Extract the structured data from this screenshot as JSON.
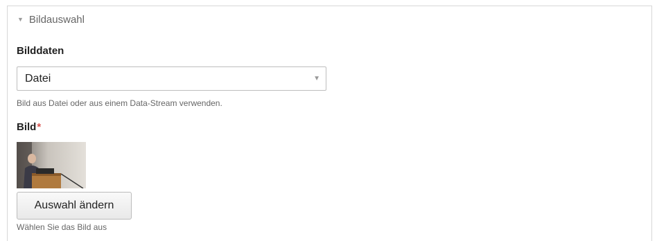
{
  "fieldset": {
    "title": "Bildauswahl",
    "collapse_icon": "triangle-down-icon"
  },
  "image_data": {
    "label": "Bilddaten",
    "select_value": "Datei",
    "select_arrow_icon": "triangle-down-icon",
    "help": "Bild aus Datei oder aus einem Data-Stream verwenden."
  },
  "image": {
    "label": "Bild",
    "required_marker": "*",
    "thumbnail_icon": "speaker-at-lectern-photo",
    "button_label": "Auswahl ändern",
    "help": "Wählen Sie das Bild aus"
  },
  "colors": {
    "required": "#d9534f",
    "border": "#d6d6d6"
  }
}
